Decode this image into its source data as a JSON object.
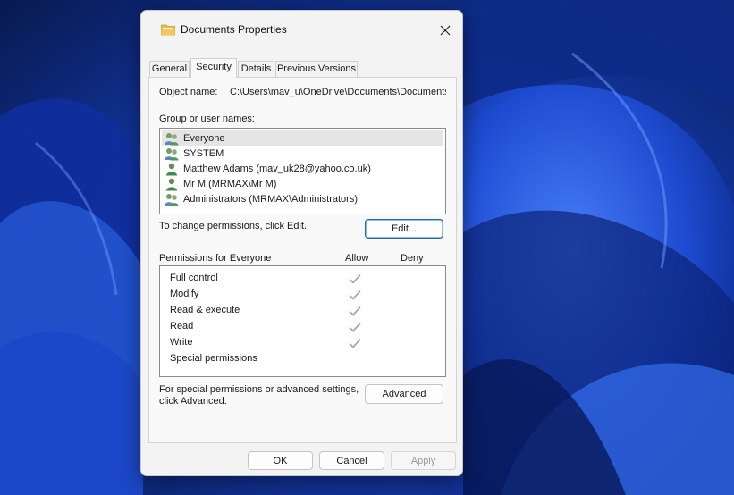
{
  "dialog": {
    "title": "Documents Properties",
    "tabs": [
      {
        "label": "General",
        "active": false
      },
      {
        "label": "Security",
        "active": true
      },
      {
        "label": "Details",
        "active": false
      },
      {
        "label": "Previous Versions",
        "active": false
      }
    ],
    "object_name_label": "Object name:",
    "object_name_value": "C:\\Users\\mav_u\\OneDrive\\Documents\\Documents",
    "group_label": "Group or user names:",
    "users": [
      {
        "name": "Everyone",
        "icon": "group-users-icon",
        "selected": true
      },
      {
        "name": "SYSTEM",
        "icon": "group-users-icon",
        "selected": false
      },
      {
        "name": "Matthew Adams (mav_uk28@yahoo.co.uk)",
        "icon": "user-icon",
        "selected": false
      },
      {
        "name": "Mr M (MRMAX\\Mr M)",
        "icon": "user-icon",
        "selected": false
      },
      {
        "name": "Administrators (MRMAX\\Administrators)",
        "icon": "group-users-icon",
        "selected": false
      }
    ],
    "change_permissions_text": "To change permissions, click Edit.",
    "edit_button": "Edit...",
    "permissions_header": "Permissions for Everyone",
    "allow_header": "Allow",
    "deny_header": "Deny",
    "permissions": [
      {
        "name": "Full control",
        "allow": true,
        "deny": false
      },
      {
        "name": "Modify",
        "allow": true,
        "deny": false
      },
      {
        "name": "Read & execute",
        "allow": true,
        "deny": false
      },
      {
        "name": "Read",
        "allow": true,
        "deny": false
      },
      {
        "name": "Write",
        "allow": true,
        "deny": false
      },
      {
        "name": "Special permissions",
        "allow": false,
        "deny": false
      }
    ],
    "advanced_text_line1": "For special permissions or advanced settings,",
    "advanced_text_line2": "click Advanced.",
    "advanced_button": "Advanced",
    "ok_button": "OK",
    "cancel_button": "Cancel",
    "apply_button": "Apply"
  },
  "colors": {
    "wallpaper_dark": "#0a1a4a",
    "wallpaper_blue": "#1f4fd8",
    "accent": "#1f6cb4",
    "check_gray": "#a8a8a8"
  }
}
